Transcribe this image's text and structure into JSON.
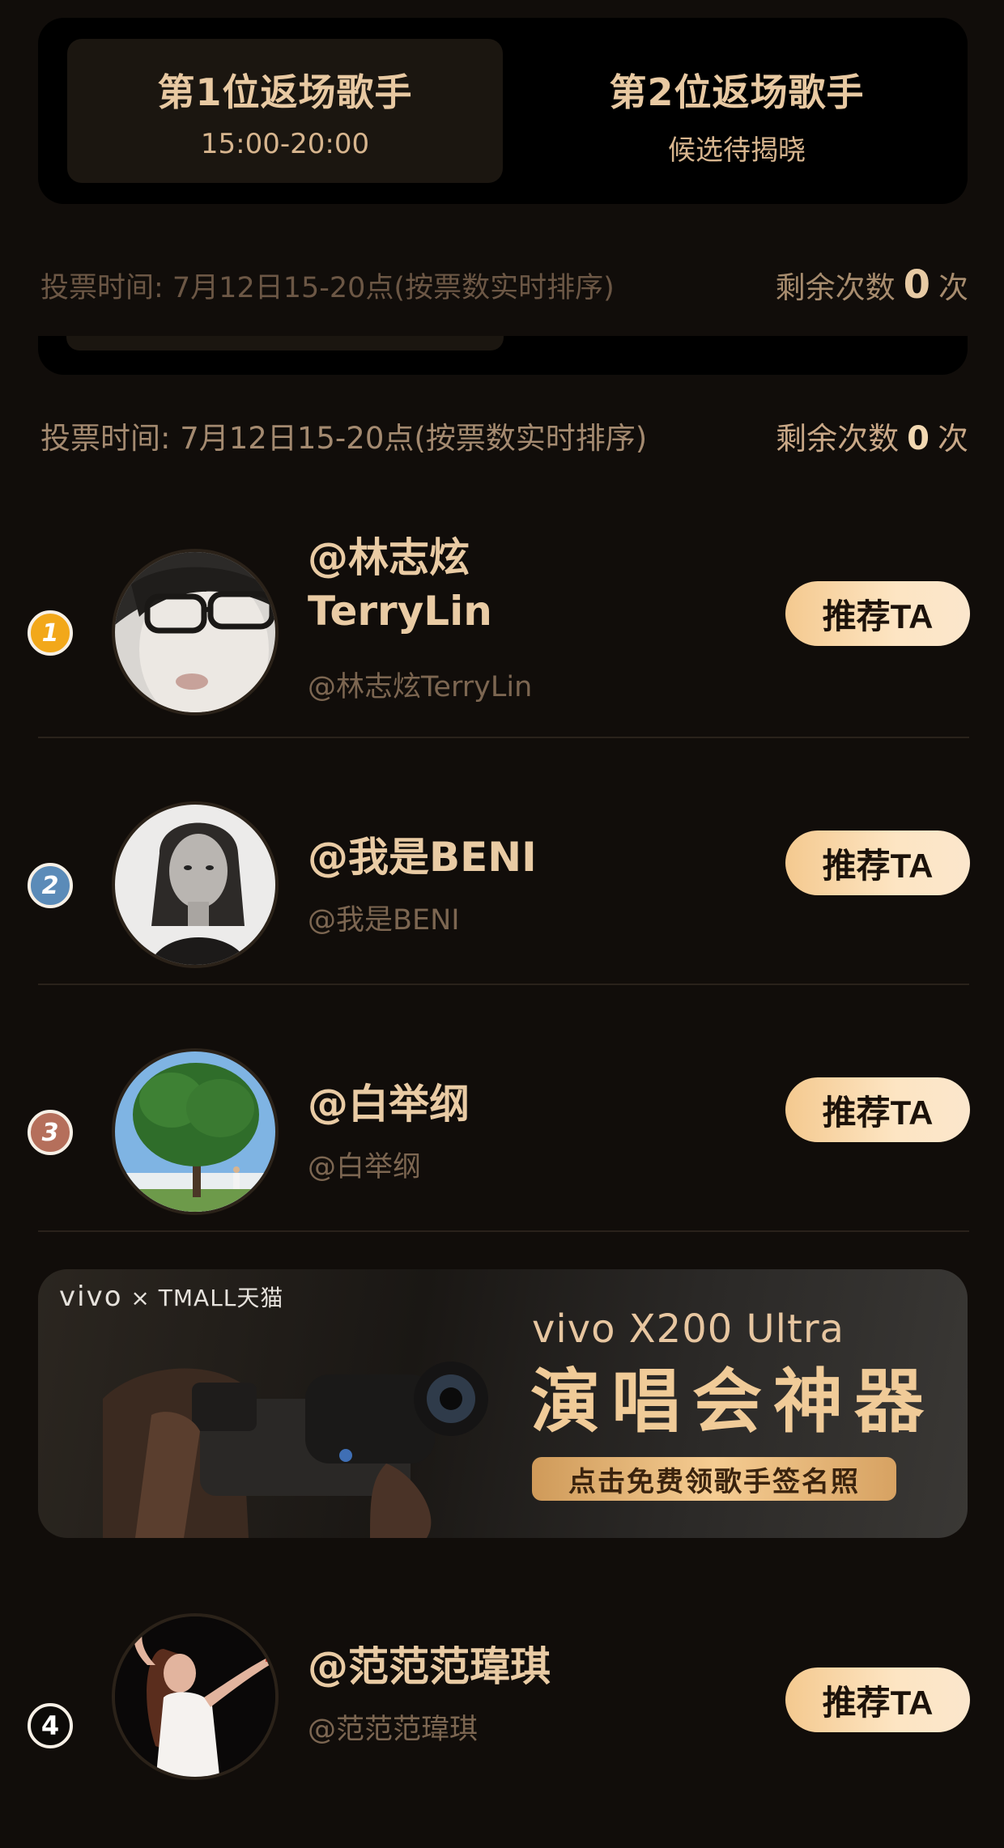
{
  "tabs": [
    {
      "title": "第1位返场歌手",
      "subtitle": "15:00-20:00",
      "active": true
    },
    {
      "title": "第2位返场歌手",
      "subtitle": "候选待揭晓",
      "active": false
    }
  ],
  "vote_info": {
    "time_text": "投票时间: 7月12日15-20点(按票数实时排序)",
    "remain_label": "剩余次数",
    "remain_count": "0",
    "remain_unit": "次"
  },
  "candidates": [
    {
      "rank": "1",
      "name": "@林志炫TerryLin",
      "name_line1": "@林志炫",
      "name_line2": "TerryLin",
      "handle": "@林志炫TerryLin",
      "button": "推荐TA",
      "avatar": "portrait-glasses-icon"
    },
    {
      "rank": "2",
      "name": "@我是BENI",
      "handle": "@我是BENI",
      "button": "推荐TA",
      "avatar": "portrait-woman-icon"
    },
    {
      "rank": "3",
      "name": "@白举纲",
      "handle": "@白举纲",
      "button": "推荐TA",
      "avatar": "tree-icon"
    },
    {
      "rank": "4",
      "name": "@范范范瑋琪",
      "handle": "@范范范瑋琪",
      "button": "推荐TA",
      "avatar": "performer-icon"
    }
  ],
  "banner": {
    "brand_vivo": "vivo",
    "brand_sep": "×",
    "brand_tmall": "TMALL天猫",
    "model": "vivo X200 Ultra",
    "headline": "演唱会神器",
    "cta": "点击免费领歌手签名照"
  },
  "colors": {
    "background": "#110d0a",
    "accent_gold": "#e8c9a2",
    "button_gradient": "#f4c98f",
    "rank1": "#f2a81a",
    "rank2": "#5b8bb8",
    "rank3": "#b56f5b"
  }
}
